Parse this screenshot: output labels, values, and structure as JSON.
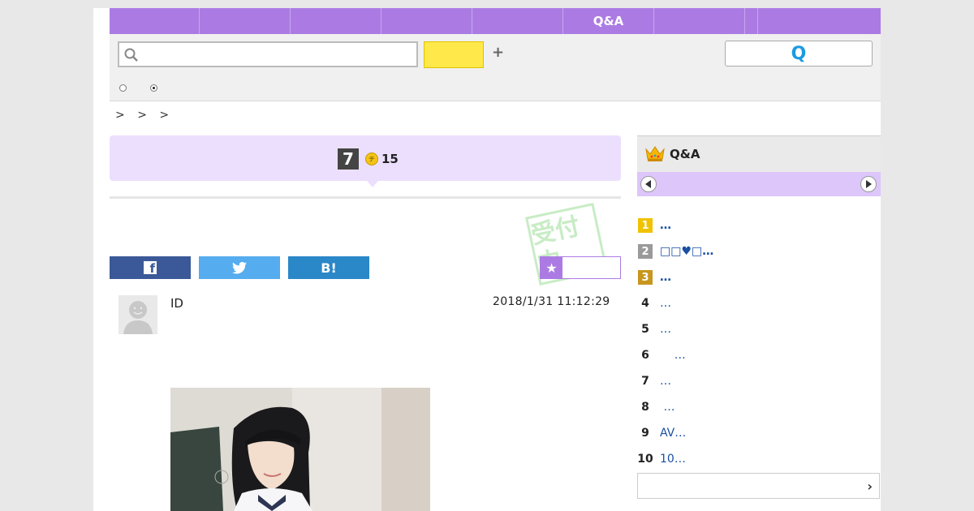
{
  "nav": {
    "items": [
      "",
      "",
      "",
      "",
      "",
      "Q&A",
      "",
      "",
      ""
    ]
  },
  "search": {
    "placeholder": "",
    "yellow_button": "",
    "plus": "+",
    "q_button": "Q"
  },
  "breadcrumb": [
    ">",
    ">",
    ">"
  ],
  "question": {
    "number": "7",
    "coin_symbol": "チ",
    "coins": "15"
  },
  "stamp": {
    "text": "受付中"
  },
  "share": {
    "facebook": "f",
    "twitter": "t",
    "hatena": "B!",
    "favorite": "★"
  },
  "post": {
    "user_id": "ID",
    "timestamp": "2018/1/31  11:12:29"
  },
  "sidebar": {
    "title": "Q&A",
    "ranking": [
      {
        "rank": "1",
        "text": "…",
        "badge": "#f0c200"
      },
      {
        "rank": "2",
        "text": "□□♥□…",
        "badge": "#9a9a9a"
      },
      {
        "rank": "3",
        "text": "…",
        "badge": "#c8961e"
      },
      {
        "rank": "4",
        "text": "…"
      },
      {
        "rank": "5",
        "text": "…"
      },
      {
        "rank": "6",
        "text": "    …"
      },
      {
        "rank": "7",
        "text": "…"
      },
      {
        "rank": "8",
        "text": " …"
      },
      {
        "rank": "9",
        "text": "AV…"
      },
      {
        "rank": "10",
        "text": "10…"
      }
    ],
    "more": "›"
  },
  "colors": {
    "accent": "#ab7be3",
    "light_accent": "#ecdffd",
    "link": "#1a4fa3"
  }
}
